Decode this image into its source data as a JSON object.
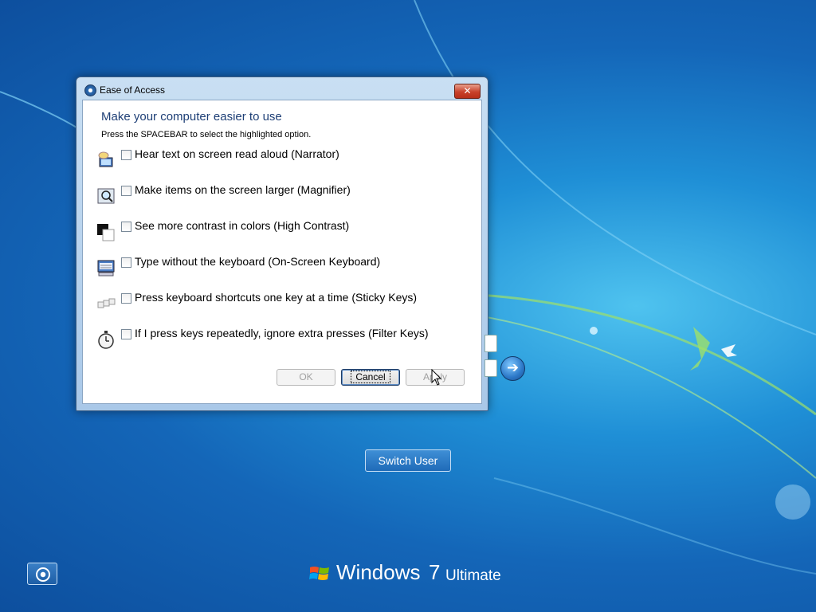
{
  "dialog": {
    "title": "Ease of Access",
    "close_label": "✕",
    "heading": "Make your computer easier to use",
    "hint": "Press the SPACEBAR to select the highlighted option.",
    "options": [
      {
        "label": "Hear text on screen read aloud (Narrator)",
        "icon": "narrator-icon",
        "checked": false
      },
      {
        "label": "Make items on the screen larger (Magnifier)",
        "icon": "magnifier-icon",
        "checked": false
      },
      {
        "label": "See more contrast in colors (High Contrast)",
        "icon": "high-contrast-icon",
        "checked": false
      },
      {
        "label": "Type without the keyboard (On-Screen Keyboard)",
        "icon": "on-screen-keyboard-icon",
        "checked": false
      },
      {
        "label": "Press keyboard shortcuts one key at a time (Sticky Keys)",
        "icon": "sticky-keys-icon",
        "checked": false
      },
      {
        "label": "If I press keys repeatedly, ignore extra presses (Filter Keys)",
        "icon": "filter-keys-icon",
        "checked": false
      }
    ],
    "buttons": {
      "ok": "OK",
      "cancel": "Cancel",
      "apply": "Apply"
    }
  },
  "login": {
    "arrow_glyph": "➔",
    "switch_user": "Switch User"
  },
  "branding": {
    "name": "Windows",
    "version": "7",
    "edition": "Ultimate"
  },
  "colors": {
    "heading": "#1e3f76",
    "background": "#1466b8",
    "close": "#c8412a"
  }
}
